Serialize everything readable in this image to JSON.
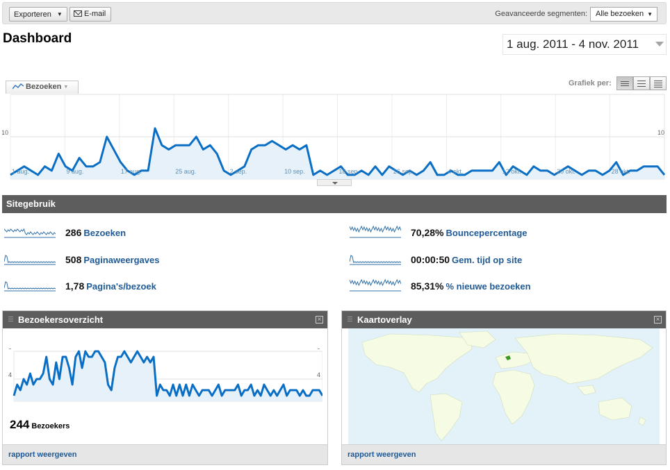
{
  "toolbar": {
    "export_label": "Exporteren",
    "email_label": "E-mail",
    "segments_label": "Geavanceerde segmenten:",
    "segments_value": "Alle bezoeken"
  },
  "header": {
    "title": "Dashboard",
    "date_range": "1 aug. 2011 - 4 nov. 2011"
  },
  "main_chart": {
    "metric_tab": "Bezoeken",
    "grafiek_per": "Grafiek per:",
    "view_modes": [
      "dag",
      "week",
      "maand"
    ],
    "active_view": "dag"
  },
  "chart_data": [
    {
      "type": "area",
      "series": [
        {
          "name": "Bezoeken",
          "values": [
            1,
            2,
            3,
            2,
            1,
            3,
            2,
            6,
            3,
            2,
            5,
            3,
            3,
            4,
            10,
            7,
            4,
            2,
            1,
            2,
            2,
            12,
            8,
            7,
            8,
            8,
            8,
            10,
            7,
            8,
            6,
            2,
            1,
            2,
            3,
            7,
            8,
            8,
            9,
            8,
            7,
            8,
            7,
            8,
            1,
            2,
            1,
            2,
            3,
            1,
            1,
            2,
            1,
            3,
            1,
            3,
            2,
            1,
            2,
            1,
            2,
            4,
            1,
            1,
            2,
            1,
            1,
            2,
            2,
            2,
            2,
            4,
            1,
            3,
            2,
            1,
            3,
            2,
            2,
            1,
            2,
            3,
            2,
            1,
            2,
            2,
            1,
            2,
            4,
            1,
            2,
            2,
            3,
            3,
            3,
            1
          ]
        }
      ],
      "x_tick_labels": [
        "1 aug.",
        "9 aug.",
        "17 aug.",
        "25 aug.",
        "2 sep.",
        "10 sep.",
        "18 sep.",
        "26 sep.",
        "4 okt.",
        "12 okt.",
        "20 okt.",
        "28 okt."
      ],
      "ylim": [
        0,
        20
      ],
      "y_ticks": [
        10,
        20
      ],
      "grid": true,
      "color": "#0a6fc4"
    },
    {
      "type": "area",
      "series": [
        {
          "name": "Bezoekers",
          "values": [
            1,
            3,
            2,
            4,
            3,
            5,
            3,
            4,
            4,
            5,
            8,
            4,
            3,
            7,
            4,
            8,
            8,
            6,
            3,
            8,
            9,
            6,
            9,
            8,
            8,
            9,
            9,
            8,
            7,
            3,
            2,
            6,
            8,
            8,
            9,
            8,
            7,
            8,
            9,
            8,
            7,
            8,
            7,
            8,
            1,
            3,
            2,
            2,
            1,
            3,
            1,
            3,
            1,
            3,
            1,
            3,
            2,
            1,
            2,
            2,
            2,
            1,
            2,
            3,
            1,
            2,
            2,
            2,
            2,
            3,
            1,
            2,
            2,
            3,
            1,
            2,
            1,
            3,
            2,
            1,
            2,
            1,
            2,
            3,
            1,
            2,
            2,
            2,
            1,
            2,
            1,
            1,
            2,
            2,
            2,
            1
          ]
        }
      ],
      "ylim": [
        0,
        9
      ],
      "y_ticks": [
        4,
        9
      ],
      "grid": true,
      "color": "#0a6fc4"
    }
  ],
  "site_usage": {
    "title": "Sitegebruik",
    "metrics": [
      {
        "value": "286",
        "label": "Bezoeken"
      },
      {
        "value": "508",
        "label": "Paginaweergaves"
      },
      {
        "value": "1,78",
        "label": "Pagina's/bezoek"
      },
      {
        "value": "70,28%",
        "label": "Bouncepercentage"
      },
      {
        "value": "00:00:50",
        "label": "Gem. tijd op site"
      },
      {
        "value": "85,31%",
        "label": "% nieuwe bezoeken"
      }
    ]
  },
  "widgets": {
    "visitors": {
      "title": "Bezoekersoverzicht",
      "count": "244",
      "count_label": "Bezoekers",
      "footer": "rapport weergeven"
    },
    "map": {
      "title": "Kaartoverlay",
      "footer": "rapport weergeven"
    }
  }
}
